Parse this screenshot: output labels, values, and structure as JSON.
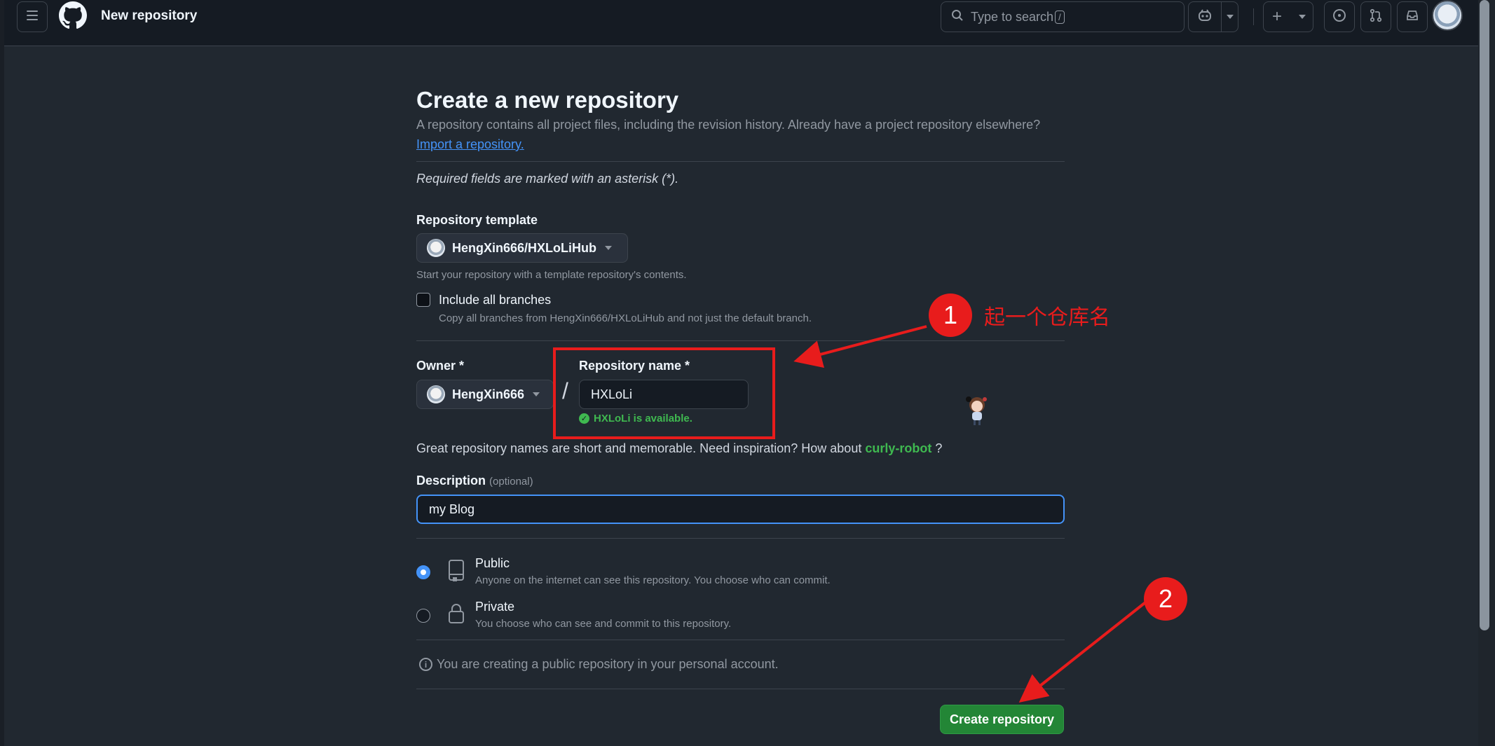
{
  "header": {
    "title": "New repository",
    "search_placeholder": "Type to search",
    "search_key": "/",
    "plus": "+"
  },
  "form": {
    "heading": "Create a new repository",
    "subtitle": "A repository contains all project files, including the revision history. Already have a project repository elsewhere?",
    "import_link": "Import a repository.",
    "required_note": "Required fields are marked with an asterisk (*).",
    "template": {
      "label": "Repository template",
      "value": "HengXin666/HXLoLiHub",
      "help": "Start your repository with a template repository's contents."
    },
    "include_branches": {
      "label": "Include all branches",
      "help": "Copy all branches from HengXin666/HXLoLiHub and not just the default branch.",
      "checked": false
    },
    "owner": {
      "label": "Owner *",
      "value": "HengXin666"
    },
    "slash": "/",
    "repo_name": {
      "label": "Repository name *",
      "value": "HXLoLi",
      "status": "HXLoLi is available."
    },
    "great_names": {
      "prefix": "Great repository names are short and memorable. Need inspiration? How about",
      "suggestion": "curly-robot",
      "suffix": "?"
    },
    "description": {
      "label": "Description",
      "optional": "(optional)",
      "value": "my Blog"
    },
    "visibility": [
      {
        "title": "Public",
        "desc": "Anyone on the internet can see this repository. You choose who can commit.",
        "checked": true
      },
      {
        "title": "Private",
        "desc": "You choose who can see and commit to this repository.",
        "checked": false
      }
    ],
    "info": "You are creating a public repository in your personal account.",
    "create_button": "Create repository"
  },
  "annotations": {
    "step1_number": "1",
    "step1_text": "起一个仓库名",
    "step2_number": "2",
    "color": "#e81c1c"
  },
  "colors": {
    "accent": "#4493f8",
    "success": "#3fb950",
    "button_green": "#238636",
    "background": "#212830"
  }
}
